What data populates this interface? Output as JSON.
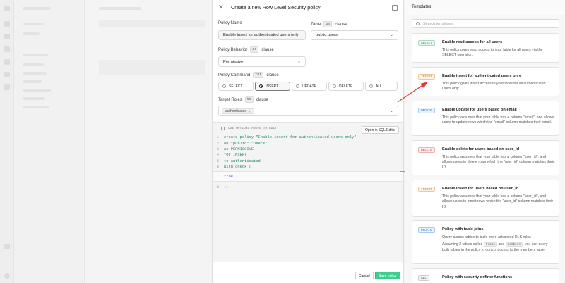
{
  "panel": {
    "title": "Create a new Row Level Security policy",
    "policy_name_label": "Policy Name",
    "policy_name_value": "Enable insert for authenticated users only",
    "table_label": "Table",
    "table_chip": "on",
    "table_clause": "clause",
    "table_value": "public.users",
    "behavior_label": "Policy Behavior",
    "behavior_chip": "as",
    "behavior_clause": "clause",
    "behavior_value": "Permissive",
    "command_label": "Policy Command",
    "command_chip": "for",
    "command_clause": "clause",
    "commands": [
      "SELECT",
      "INSERT",
      "UPDATE",
      "DELETE",
      "ALL"
    ],
    "active_command": "INSERT",
    "roles_label": "Target Roles",
    "roles_chip": "to",
    "roles_clause": "clause",
    "role_tag": "authenticated",
    "role_remove": "×"
  },
  "editor": {
    "hint": "USE OPTIONS ABOVE TO EDIT",
    "open_sql_label": "Open in SQL Editor",
    "lines": [
      {
        "n": "1",
        "text": "create policy \"Enable insert for authenticated users only\""
      },
      {
        "n": "2",
        "text": "on \"public\".\"users\""
      },
      {
        "n": "3",
        "text": "as PERMISSIVE"
      },
      {
        "n": "4",
        "text": "for INSERT"
      },
      {
        "n": "5",
        "text": "to authenticated"
      },
      {
        "n": "6",
        "text": "with check ("
      },
      {
        "n": "7",
        "text": "true"
      },
      {
        "n": "8",
        "text": ");"
      }
    ]
  },
  "footer": {
    "cancel_label": "Cancel",
    "save_label": "Save policy"
  },
  "templates": {
    "tab_label": "Templates",
    "search_placeholder": "Search templates",
    "cards": [
      {
        "badge": "SELECT",
        "title": "Enable read access for all users",
        "desc": "This policy gives read access to your table for all users via the SELECT operation.",
        "color": "#1f9d63",
        "bg": "#eaf7f0",
        "border": "#a8dcc1"
      },
      {
        "badge": "INSERT",
        "title": "Enable insert for authenticated users only",
        "desc": "This policy gives insert access to your table for all authenticated users only.",
        "color": "#d77a1e",
        "bg": "#fdf2e7",
        "border": "#f0c79b"
      },
      {
        "badge": "UPDATE",
        "title": "Enable update for users based on email",
        "desc": "This policy assumes that your table has a column \"email\", and allows users to update rows which the \"email\" column matches their email.",
        "color": "#2f79c9",
        "bg": "#e9f2fb",
        "border": "#a9c9ec"
      },
      {
        "badge": "DELETE",
        "title": "Enable delete for users based on user_id",
        "desc": "This policy assumes that your table has a column \"user_id\", and allows users to delete rows which the \"user_id\" column matches their ID",
        "color": "#d13f3f",
        "bg": "#fcecec",
        "border": "#efb1b1"
      },
      {
        "badge": "INSERT",
        "title": "Enable insert for users based on user_id",
        "desc": "This policy assumes that your table has a column \"user_id\", and allows users to insert rows which the \"user_id\" column matches their ID",
        "color": "#d77a1e",
        "bg": "#fdf2e7",
        "border": "#f0c79b"
      },
      {
        "badge": "UPDATE",
        "title": "Policy with table joins",
        "desc": "Query across tables to build more advanced RLS rules",
        "desc2a": "Assuming 2 tables called",
        "chip1": "teams",
        "desc2b": "and",
        "chip2": "members",
        "desc2c": ", you can query both tables in the policy to control access to the members table.",
        "color": "#2f79c9",
        "bg": "#e9f2fb",
        "border": "#a9c9ec"
      },
      {
        "badge": "ALL",
        "title": "Policy with security definer functions",
        "desc": "",
        "color": "#555555",
        "bg": "#f3f3f3",
        "border": "#cfcfcf"
      }
    ]
  },
  "colors": {
    "accent_green": "#3ecf8e",
    "arrow_red": "#e53935"
  }
}
